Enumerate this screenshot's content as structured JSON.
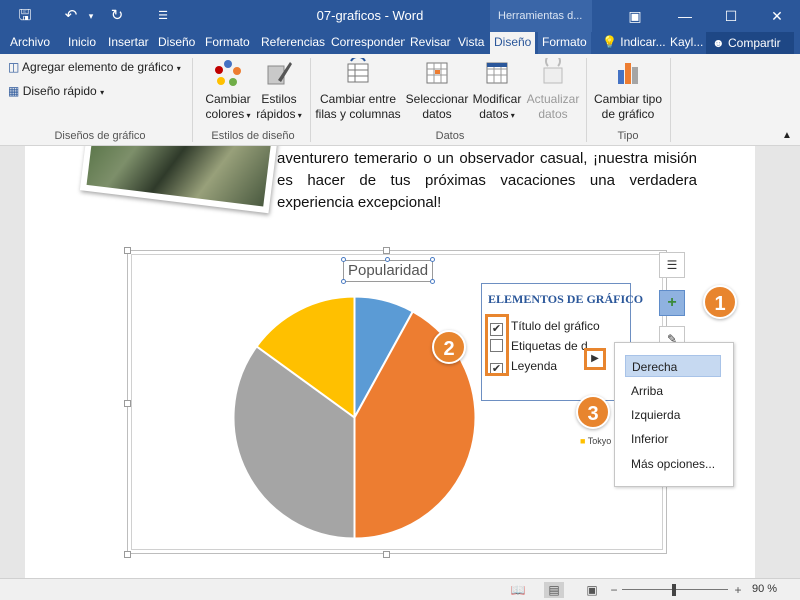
{
  "window": {
    "doc_title": "07-graficos - Word",
    "context_tools": "Herramientas d...",
    "colors": {
      "titlebar": "#2b579a",
      "accent": "#e8852e"
    }
  },
  "tabs": [
    {
      "label": "Archivo"
    },
    {
      "label": "Inicio"
    },
    {
      "label": "Insertar"
    },
    {
      "label": "Diseño"
    },
    {
      "label": "Formato"
    },
    {
      "label": "Referencias"
    },
    {
      "label": "Correspondencia"
    },
    {
      "label": "Revisar"
    },
    {
      "label": "Vista"
    },
    {
      "label": "Diseño"
    },
    {
      "label": "Formato"
    },
    {
      "label": "Indicar..."
    },
    {
      "label": "Kayl..."
    }
  ],
  "share_label": "Compartir",
  "ribbon": {
    "add_element": "Agregar elemento de gráfico",
    "quick_layout": "Diseño rápido",
    "group_layouts": "Diseños de gráfico",
    "change_colors": [
      "Cambiar",
      "colores"
    ],
    "quick_styles": [
      "Estilos",
      "rápidos"
    ],
    "group_styles": "Estilos de diseño",
    "switch_row_col": [
      "Cambiar entre",
      "filas y columnas"
    ],
    "select_data": [
      "Seleccionar",
      "datos"
    ],
    "edit_data": [
      "Modificar",
      "datos"
    ],
    "refresh_data": [
      "Actualizar",
      "datos"
    ],
    "group_data": "Datos",
    "change_type": [
      "Cambiar tipo",
      "de gráfico"
    ],
    "group_type": "Tipo"
  },
  "document": {
    "paragraph_lines": [
      "aventurero temerario o un observador casual, ¡nuestra",
      "misión es hacer de tus próximas vacaciones una",
      "verdadera experiencia excepcional!"
    ]
  },
  "chart_data": {
    "type": "pie",
    "title": "Popularidad",
    "categories": [
      "Blue slice",
      "Orange slice",
      "Gray slice",
      "Yellow slice"
    ],
    "values": [
      8,
      42,
      35,
      15
    ],
    "colors": [
      "#5b9bd5",
      "#ed7d31",
      "#a5a5a5",
      "#ffc000"
    ],
    "legend_visible_fragment": "Tokyo"
  },
  "elements_popup": {
    "header": "ELEMENTOS DE GRÁFICO",
    "items": [
      {
        "label": "Título del gráfico",
        "checked": true
      },
      {
        "label": "Etiquetas de d...",
        "checked": false
      },
      {
        "label": "Leyenda",
        "checked": true
      }
    ]
  },
  "submenu": {
    "items": [
      {
        "label": "Derecha",
        "selected": true
      },
      {
        "label": "Arriba"
      },
      {
        "label": "Izquierda"
      },
      {
        "label": "Inferior"
      },
      {
        "label": "Más opciones..."
      }
    ]
  },
  "callouts": [
    "1",
    "2",
    "3"
  ],
  "status": {
    "zoom": "90 %"
  }
}
